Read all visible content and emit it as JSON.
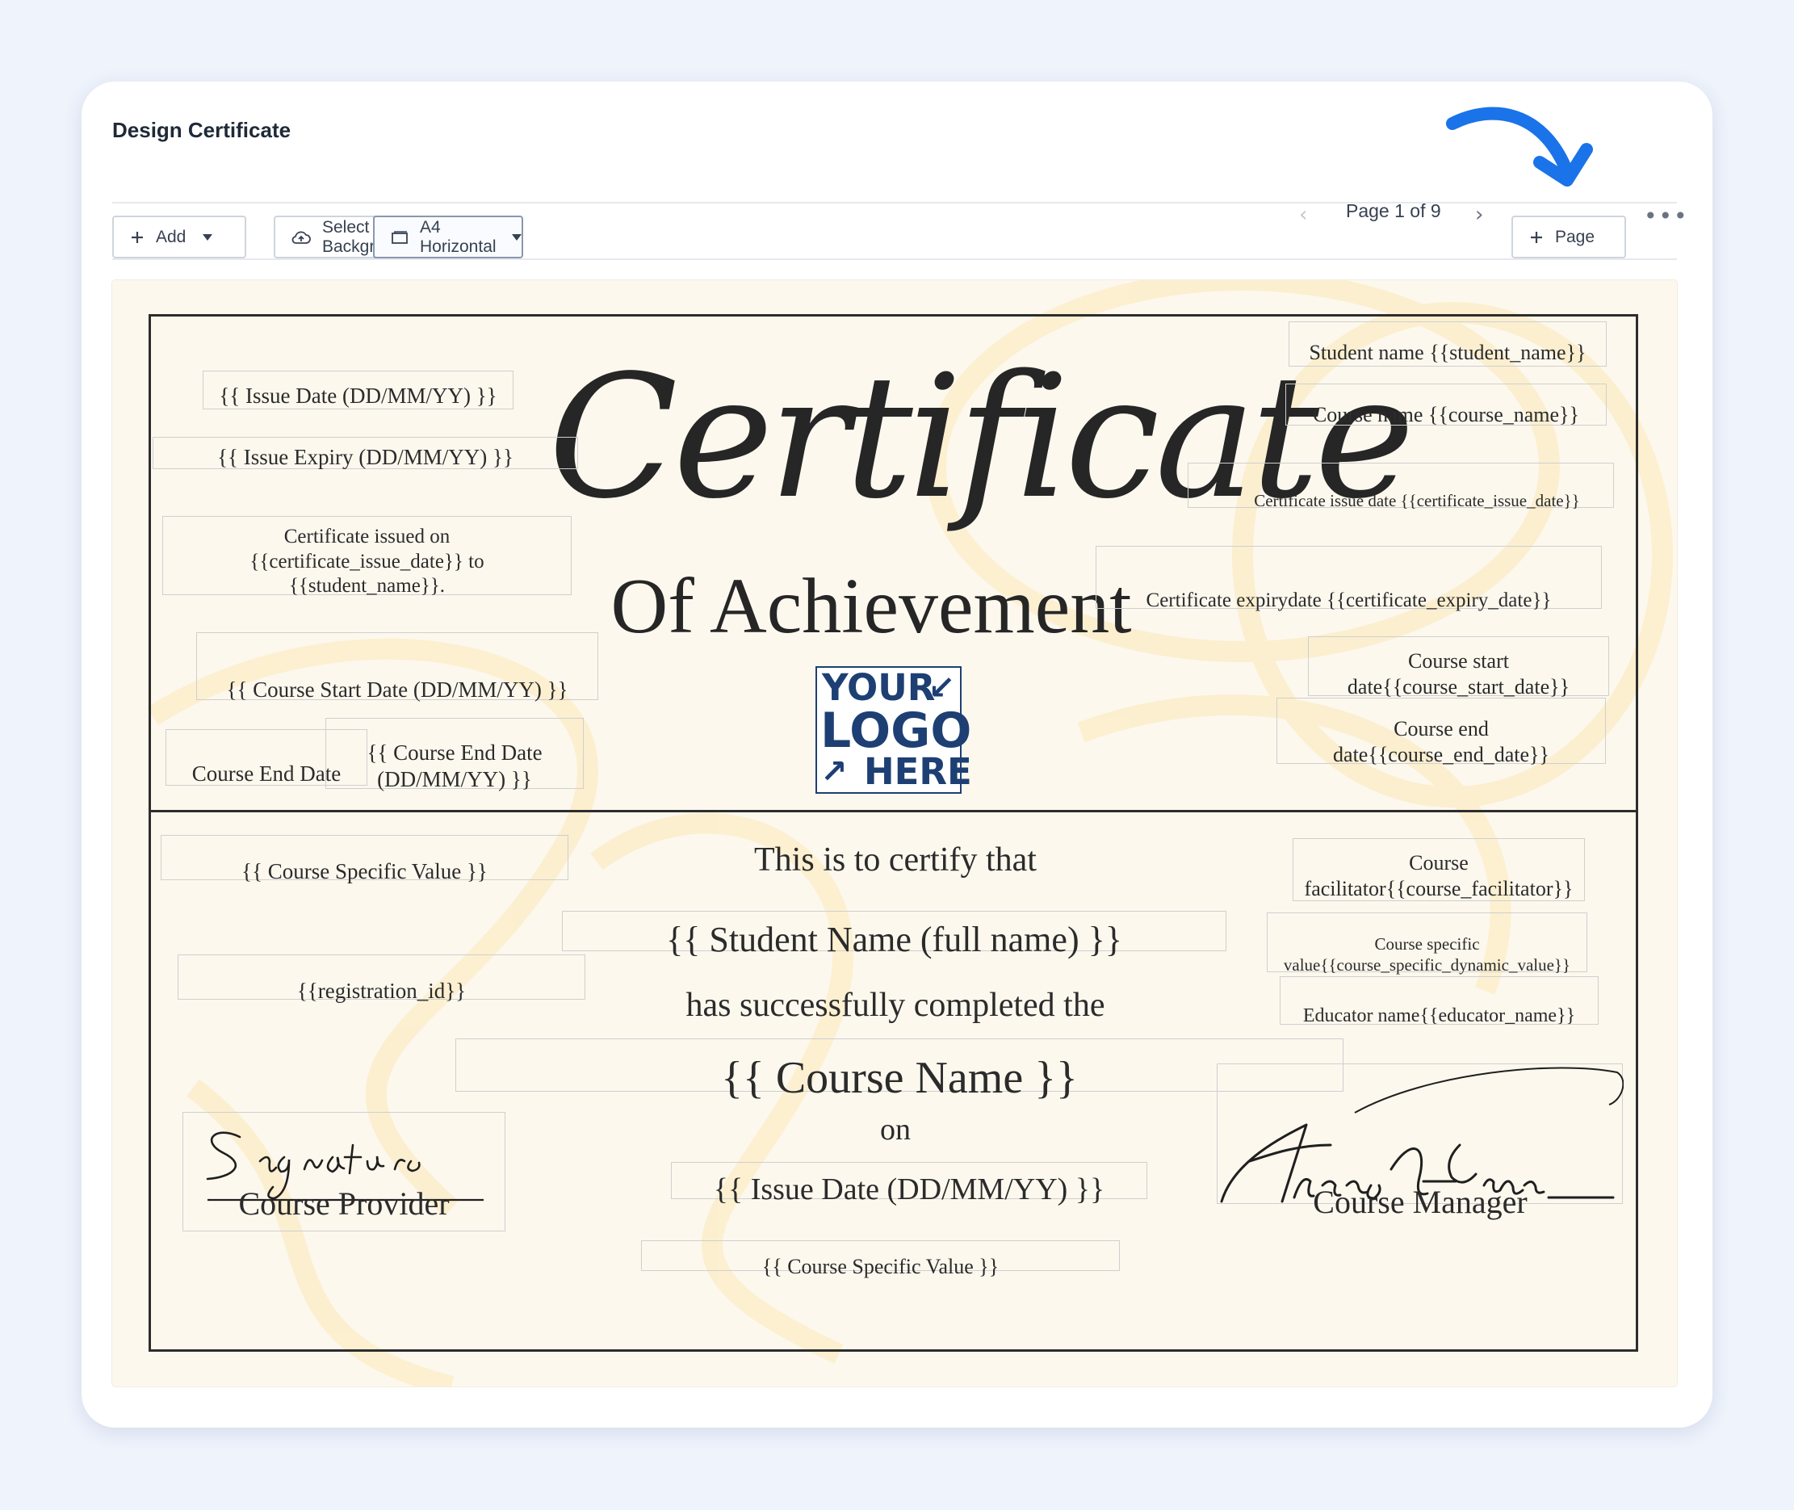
{
  "header": {
    "title": "Design Certificate"
  },
  "toolbar": {
    "add_label": "Add",
    "background_label": "Select Background",
    "page_size_label": "A4 Horizontal",
    "page_indicator": "Page 1 of 9",
    "add_page_label": "Page"
  },
  "certificate": {
    "title_script": "Certificate",
    "subtitle": "Of Achievement",
    "logo": {
      "line1": "YOUR",
      "line2": "LOGO",
      "line3": "HERE"
    },
    "fields": {
      "issue_date": "{{ Issue Date (DD/MM/YY) }}",
      "issue_expiry": "{{ Issue Expiry (DD/MM/YY) }}",
      "issued_on": "Certificate issued on {{certificate_issue_date}} to {{student_name}}.",
      "course_start": "{{ Course Start Date (DD/MM/YY) }}",
      "course_end_label": "Course End Date",
      "course_end_date": "{{ Course End Date (DD/MM/YY) }}",
      "student_name_right": "Student name {{student_name}}",
      "course_name_right": "Course name {{course_name}}",
      "cert_issue_date_right": "Certificate issue date {{certificate_issue_date}}",
      "cert_expiry_right": "Certificate expirydate {{certificate_expiry_date}}",
      "course_start_right": "Course start date{{course_start_date}}",
      "course_end_right": "Course end date{{course_end_date}}",
      "course_specific_left": "{{ Course Specific Value }}",
      "registration_id": "{{registration_id}}",
      "facilitator": "Course facilitator{{course_facilitator}}",
      "course_specific_dynamic": "Course specific value{{course_specific_dynamic_value}}",
      "educator": "Educator name{{educator_name}}",
      "certify_text": "This is to certify that",
      "student_full_name": "{{ Student Name (full name) }}",
      "completed_text": "has successfully completed the",
      "course_name_center": "{{ Course Name }}",
      "on_text": "on",
      "issue_date_center": "{{ Issue Date (DD/MM/YY) }}",
      "course_specific_center": "{{ Course Specific Value }}"
    },
    "signatures": {
      "provider_label": "Course Provider",
      "manager_label": "Course Manager",
      "provider_signature": "Signature",
      "manager_signature": "Thomas A Edison"
    }
  },
  "colors": {
    "accent": "#1a73e8",
    "canvas": "#fdf8ee",
    "logo": "#1d3f73"
  }
}
